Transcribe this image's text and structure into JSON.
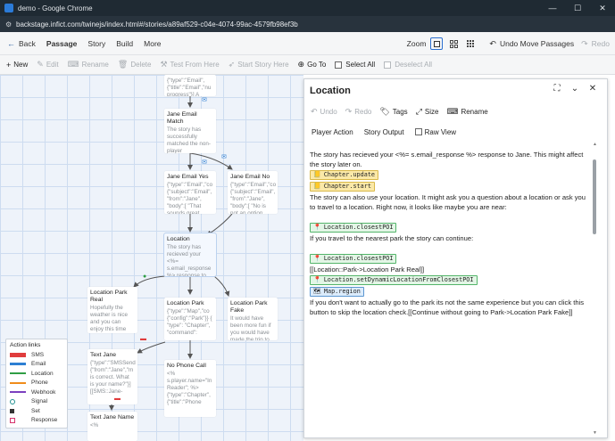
{
  "window": {
    "title": "demo - Google Chrome",
    "url": "backstage.infict.com/twinejs/index.html#/stories/a89af529-c04e-4074-99ac-4579fb98ef3b"
  },
  "topnav": {
    "back": "Back",
    "passage": "Passage",
    "story": "Story",
    "build": "Build",
    "more": "More",
    "zoom": "Zoom",
    "undo": "Undo Move Passages",
    "redo": "Redo"
  },
  "toolbar": {
    "new": "New",
    "edit": "Edit",
    "rename": "Rename",
    "delete": "Delete",
    "test_from_here": "Test From Here",
    "start_story_here": "Start Story Here",
    "go_to": "Go To",
    "select_all": "Select All",
    "deselect_all": "Deselect All"
  },
  "passages": [
    {
      "title": "",
      "excerpt": "{\"type\":\"Email\", {\"title\":\"Email\",\"nu progress\"}] A"
    },
    {
      "title": "Jane Email Match",
      "excerpt": "The story has successfully matched the non-player"
    },
    {
      "title": "Jane Email Yes",
      "excerpt": "{\"type\":\"Email\",\"co {\"subject\":\"Email\", \"from\":\"Jane\", \"body\":[ \"That sounds great."
    },
    {
      "title": "Jane Email No",
      "excerpt": "{\"type\":\"Email\",\"co {\"subject\":\"Email\", \"from\":\"Jane\", \"body\":[ \"No is not an option."
    },
    {
      "title": "Location",
      "excerpt": "The story has recieved your <%= s.email_response %> response to"
    },
    {
      "title": "Location Park Real",
      "excerpt": "Hopefully the weather is nice and you can enjoy this time"
    },
    {
      "title": "Location Park",
      "excerpt": "{\"type\":\"Map\",\"co {\"config\":\"Park\"}} { \"type\": \"Chapter\", \"command\":"
    },
    {
      "title": "Location Park Fake",
      "excerpt": "It would have been more fun if you would have made the trip to"
    },
    {
      "title": "Text Jane",
      "excerpt": "{\"type\":\"SMSSend {\"from\":\"Jane\",\"m is correct. What is your name?\"}] [[SMS::Jane-"
    },
    {
      "title": "No Phone Call",
      "excerpt": "<% s.player.name=\"In Reader\"; %> {\"type\":\"Chapter\", {\"title\":\"Phone"
    },
    {
      "title": "Text Jane Name",
      "excerpt": "<%"
    }
  ],
  "legend": {
    "title": "Action links",
    "items": [
      {
        "label": "SMS",
        "color": "#e03c3c"
      },
      {
        "label": "Email",
        "color": "#2d7fd3"
      },
      {
        "label": "Location",
        "color": "#2f9e44"
      },
      {
        "label": "Phone",
        "color": "#f08c1a"
      },
      {
        "label": "Webhook",
        "color": "#7b3fbf"
      },
      {
        "label": "Signal",
        "color": "#1f8f8f"
      },
      {
        "label": "Set",
        "color": "#333333"
      },
      {
        "label": "Response",
        "color": "#d6336c"
      }
    ]
  },
  "dialog": {
    "title": "Location",
    "tools": {
      "undo": "Undo",
      "redo": "Redo",
      "tags": "Tags",
      "size": "Size",
      "rename": "Rename"
    },
    "tabs": {
      "player_action": "Player Action",
      "story_output": "Story Output",
      "raw_view": "Raw View"
    },
    "body": {
      "p1": "The story has recieved your <%= s.email_response %> response to Jane. This might affect the story later on.",
      "chip_update": "Chapter.update",
      "chip_start": "Chapter.start",
      "p2": "The story can also use your location. It might ask you a question about a location or ask you to travel to a location. Right now, it looks like maybe you are near:",
      "chip_closest1": "Location.closestPOI",
      "p3": "If you travel to the nearest park the story can continue:",
      "chip_closest2": "Location.closestPOI",
      "p4": "[[Location::Park->Location Park Real]]",
      "chip_dynamic": "Location.setDynamicLocationFromClosestPOI",
      "chip_map": "Map.region",
      "p5": "If you don't want to actually go to the park its not the same experience but you can click this button to skip the location check.[[Continue without going to Park->Location Park Fake]]"
    }
  }
}
